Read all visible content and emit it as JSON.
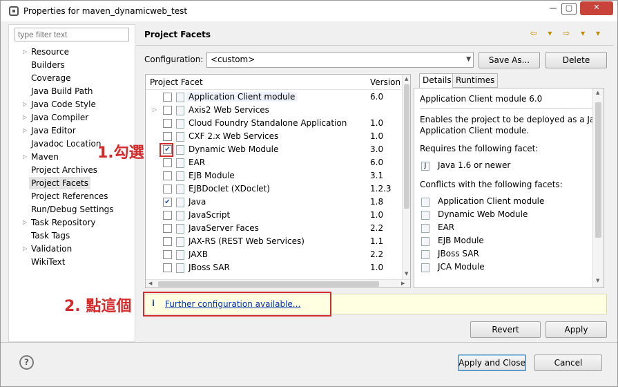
{
  "window": {
    "title": "Properties for maven_dynamicweb_test",
    "min": "—",
    "max": "▢",
    "close": "✕"
  },
  "filter_placeholder": "type filter text",
  "nav": [
    {
      "label": "Resource",
      "arrow": true
    },
    {
      "label": "Builders",
      "arrow": false
    },
    {
      "label": "Coverage",
      "arrow": false
    },
    {
      "label": "Java Build Path",
      "arrow": false
    },
    {
      "label": "Java Code Style",
      "arrow": true
    },
    {
      "label": "Java Compiler",
      "arrow": true
    },
    {
      "label": "Java Editor",
      "arrow": true
    },
    {
      "label": "Javadoc Location",
      "arrow": false
    },
    {
      "label": "Maven",
      "arrow": true
    },
    {
      "label": "Project Archives",
      "arrow": false
    },
    {
      "label": "Project Facets",
      "arrow": false,
      "selected": true
    },
    {
      "label": "Project References",
      "arrow": false
    },
    {
      "label": "Run/Debug Settings",
      "arrow": false
    },
    {
      "label": "Task Repository",
      "arrow": true
    },
    {
      "label": "Task Tags",
      "arrow": false
    },
    {
      "label": "Validation",
      "arrow": true
    },
    {
      "label": "WikiText",
      "arrow": false
    }
  ],
  "page_title": "Project Facets",
  "nav_arrows": "⇦ ▾ ⇨ ▾ ▾",
  "config": {
    "label": "Configuration:",
    "value": "<custom>",
    "save_as": "Save As...",
    "delete": "Delete"
  },
  "facets_header": {
    "facet": "Project Facet",
    "version": "Version"
  },
  "facets": [
    {
      "name": "Application Client module",
      "version": "6.0",
      "checked": false,
      "highlight": true,
      "expand": false
    },
    {
      "name": "Axis2 Web Services",
      "version": "",
      "checked": false,
      "expand": true
    },
    {
      "name": "Cloud Foundry Standalone Application",
      "version": "1.0",
      "checked": false,
      "expand": false
    },
    {
      "name": "CXF 2.x Web Services",
      "version": "1.0",
      "checked": false,
      "expand": false
    },
    {
      "name": "Dynamic Web Module",
      "version": "3.0",
      "checked": true,
      "expand": false
    },
    {
      "name": "EAR",
      "version": "6.0",
      "checked": false,
      "expand": false
    },
    {
      "name": "EJB Module",
      "version": "3.1",
      "checked": false,
      "expand": false
    },
    {
      "name": "EJBDoclet (XDoclet)",
      "version": "1.2.3",
      "checked": false,
      "expand": false
    },
    {
      "name": "Java",
      "version": "1.8",
      "checked": true,
      "expand": false
    },
    {
      "name": "JavaScript",
      "version": "1.0",
      "checked": false,
      "expand": false
    },
    {
      "name": "JavaServer Faces",
      "version": "2.2",
      "checked": false,
      "expand": false
    },
    {
      "name": "JAX-RS (REST Web Services)",
      "version": "1.1",
      "checked": false,
      "expand": false
    },
    {
      "name": "JAXB",
      "version": "2.2",
      "checked": false,
      "expand": false
    },
    {
      "name": "JBoss SAR",
      "version": "1.0",
      "checked": false,
      "expand": false
    }
  ],
  "tabs": {
    "details": "Details",
    "runtimes": "Runtimes"
  },
  "details": {
    "title": "Application Client module 6.0",
    "desc1": "Enables the project to be deployed as a Jav",
    "desc2": "Application Client module.",
    "requires_label": "Requires the following facet:",
    "requires": [
      "Java 1.6 or newer"
    ],
    "conflicts_label": "Conflicts with the following facets:",
    "conflicts": [
      "Application Client module",
      "Dynamic Web Module",
      "EAR",
      "EJB Module",
      "JBoss SAR",
      "JCA Module"
    ]
  },
  "info": {
    "icon": "i",
    "link": "Further configuration available..."
  },
  "buttons": {
    "revert": "Revert",
    "apply": "Apply",
    "apply_close": "Apply and Close",
    "cancel": "Cancel",
    "help": "?"
  },
  "annotations": {
    "step1": "1.勾選",
    "step2": "2. 點這個"
  },
  "colors": {
    "annotation": "#d42a2a",
    "link": "#0033b5",
    "infobar": "#ffffe1"
  }
}
